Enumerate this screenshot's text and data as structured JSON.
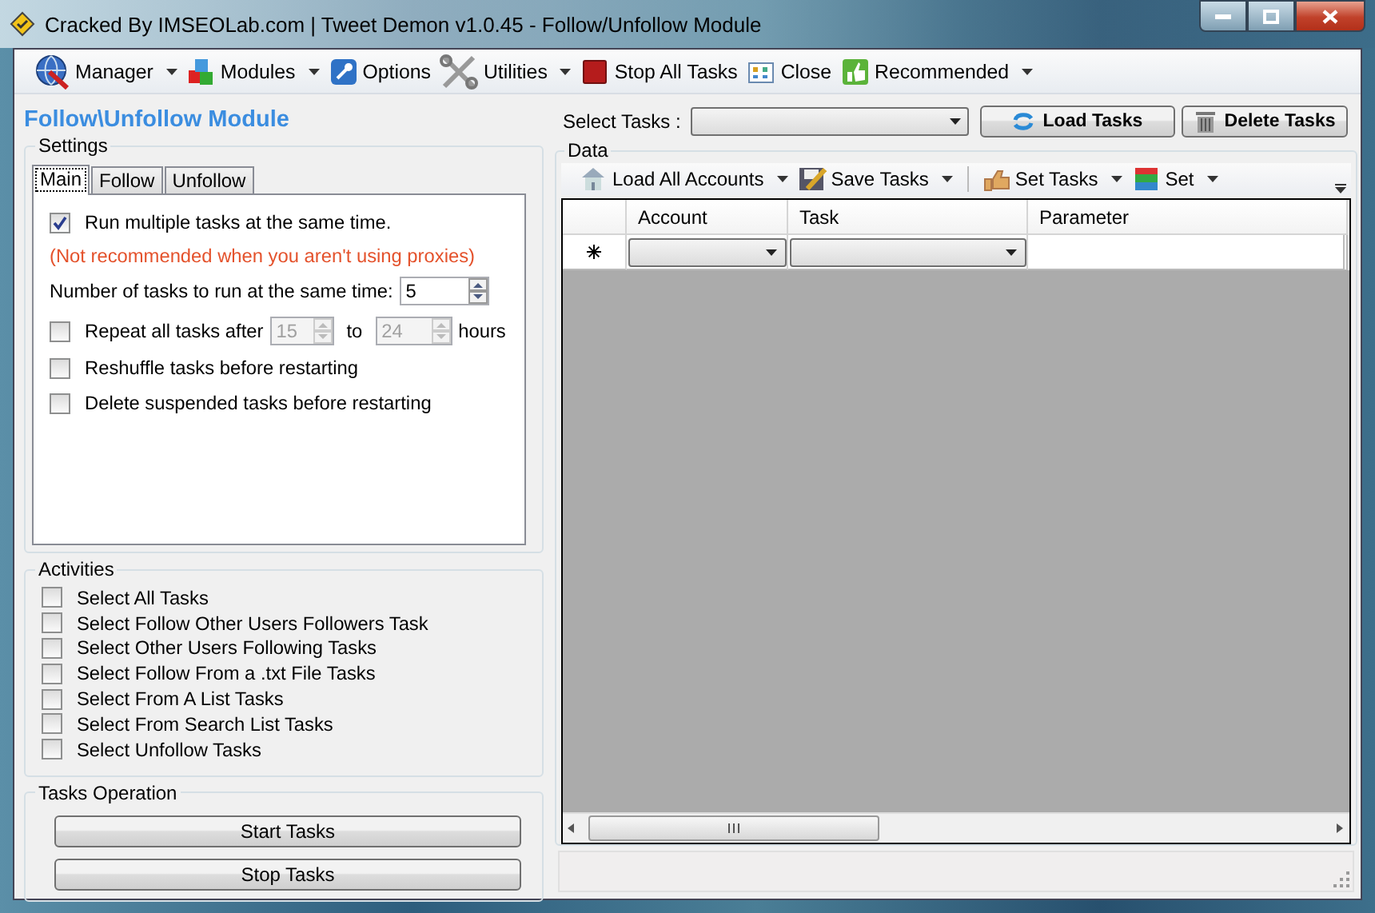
{
  "window": {
    "title": "Cracked By IMSEOLab.com | Tweet Demon v1.0.45 - Follow/Unfollow Module"
  },
  "toolbar": [
    {
      "label": "Manager",
      "kind": "globe",
      "dropdown": true
    },
    {
      "label": "Modules",
      "kind": "blocks",
      "dropdown": true
    },
    {
      "label": "Options",
      "kind": "key",
      "dropdown": false
    },
    {
      "label": "Utilities",
      "kind": "tools",
      "dropdown": true
    },
    {
      "label": "Stop All Tasks",
      "kind": "stop",
      "dropdown": false
    },
    {
      "label": "Close",
      "kind": "calendar",
      "dropdown": false
    },
    {
      "label": "Recommended",
      "kind": "thumb",
      "dropdown": true
    }
  ],
  "heading": "Follow\\Unfollow Module",
  "settings": {
    "title": "Settings",
    "tabs": [
      {
        "label": "Main",
        "selected": true
      },
      {
        "label": "Follow",
        "selected": false
      },
      {
        "label": "Unfollow",
        "selected": false
      }
    ],
    "run_multiple": {
      "label": "Run multiple tasks at the same time.",
      "checked": true
    },
    "warning": "(Not recommended when you aren't using proxies)",
    "task_count": {
      "label": "Number of tasks to run at the same time:",
      "value": "5",
      "disabled": false
    },
    "repeat": {
      "label": "Repeat all tasks after",
      "checked": false,
      "from": {
        "value": "15",
        "disabled": true
      },
      "between": "to",
      "to": {
        "value": "24",
        "disabled": true
      },
      "unit": "hours"
    },
    "options": [
      {
        "label": "Reshuffle tasks before restarting",
        "checked": false
      },
      {
        "label": "Delete suspended tasks before restarting",
        "checked": false
      }
    ]
  },
  "activities": {
    "title": "Activities",
    "items": [
      {
        "label": "Select All Tasks",
        "checked": false
      },
      {
        "label": "Select Follow Other Users Followers Task",
        "checked": false
      },
      {
        "label": "Select Other Users Following Tasks",
        "checked": false
      },
      {
        "label": "Select Follow From a .txt File Tasks",
        "checked": false
      },
      {
        "label": "Select From A List Tasks",
        "checked": false
      },
      {
        "label": "Select From Search List Tasks",
        "checked": false
      },
      {
        "label": "Select Unfollow Tasks",
        "checked": false
      }
    ]
  },
  "tasks_operation": {
    "title": "Tasks Operation",
    "buttons": [
      "Start Tasks",
      "Stop Tasks"
    ]
  },
  "select_tasks": {
    "label": "Select Tasks :"
  },
  "task_buttons": [
    {
      "label": "Load Tasks",
      "kind": "refresh"
    },
    {
      "label": "Delete Tasks",
      "kind": "trash"
    }
  ],
  "data": {
    "title": "Data",
    "toolbar": [
      {
        "label": "Load All Accounts",
        "kind": "house",
        "separator_after": false
      },
      {
        "label": "Save Tasks",
        "kind": "save",
        "separator_after": true
      },
      {
        "label": "Set Tasks",
        "kind": "hand",
        "separator_after": false
      },
      {
        "label": "Set",
        "kind": "cube",
        "separator_after": false
      }
    ],
    "columns": [
      "Account",
      "Task",
      "Parameter"
    ]
  }
}
